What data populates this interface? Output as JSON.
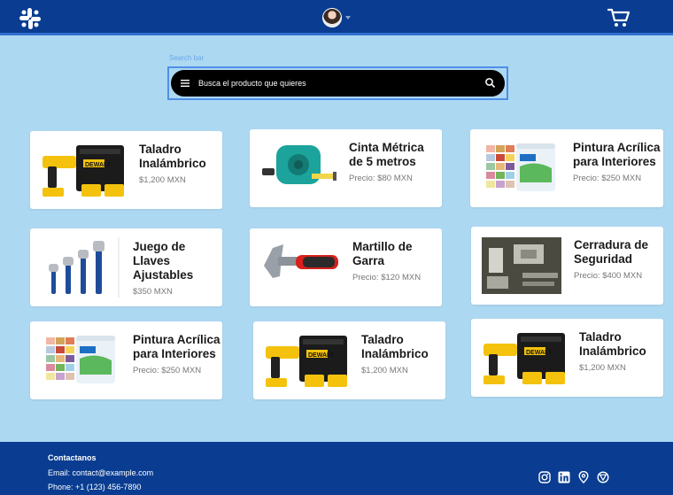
{
  "header": {
    "logo_icon": "slack-logo-icon",
    "avatar_icon": "user-avatar",
    "cart_icon": "shopping-cart-icon"
  },
  "search": {
    "label": "Search bar",
    "placeholder": "Busca el producto que quieres",
    "menu_icon": "hamburger-menu-icon",
    "search_icon": "magnifier-icon"
  },
  "products": [
    {
      "title_lines": [
        "Taladro",
        "Inalámbrico"
      ],
      "price": "$1,200 MXN",
      "image": "cordless-drill-kit"
    },
    {
      "title_lines": [
        "Cinta Métrica",
        "de 5 metros"
      ],
      "price": "Precio: $80 MXN",
      "image": "tape-measure"
    },
    {
      "title_lines": [
        "Pintura Acrílica",
        "para Interiores"
      ],
      "price": "Precio: $250 MXN",
      "image": "paint-bucket"
    },
    {
      "title_lines": [
        "Juego de",
        "Llaves",
        "Ajustables"
      ],
      "price": "$350 MXN",
      "image": "adjustable-wrenches"
    },
    {
      "title_lines": [
        "Martillo de",
        "Garra"
      ],
      "price": "Precio: $120 MXN",
      "image": "claw-hammer"
    },
    {
      "title_lines": [
        "Cerradura de",
        "Seguridad"
      ],
      "price": "Precio: $400 MXN",
      "image": "security-lock"
    },
    {
      "title_lines": [
        "Pintura Acrílica",
        "para Interiores"
      ],
      "price": "Precio: $250 MXN",
      "image": "paint-bucket"
    },
    {
      "title_lines": [
        "Taladro",
        "Inalámbrico"
      ],
      "price": "$1,200 MXN",
      "image": "cordless-drill-kit"
    },
    {
      "title_lines": [
        "Taladro",
        "Inalámbrico"
      ],
      "price": "$1,200 MXN",
      "image": "cordless-drill-kit"
    }
  ],
  "footer": {
    "title": "Contactanos",
    "email": "Email: contact@example.com",
    "phone": "Phone: +1 (123) 456-7890",
    "social_icons": [
      "instagram-icon",
      "linkedin-icon",
      "location-icon",
      "web-icon"
    ]
  },
  "colors": {
    "background": "#add8f2",
    "header": "#0a3d91",
    "search_bg": "#000000",
    "card": "#ffffff"
  }
}
